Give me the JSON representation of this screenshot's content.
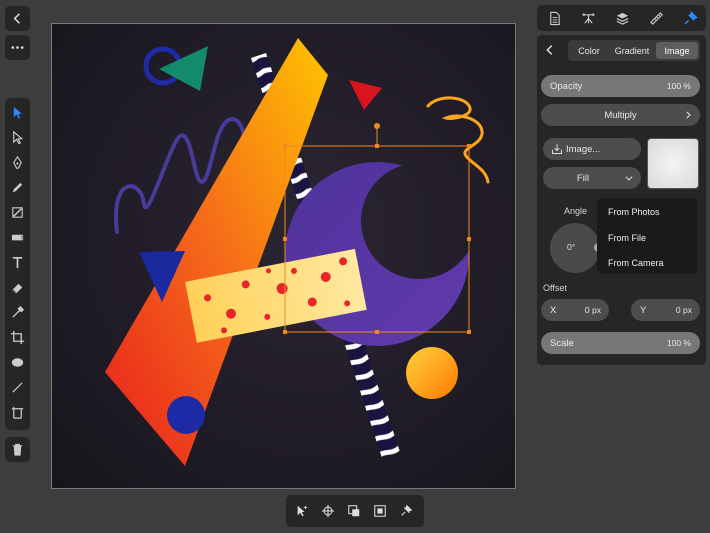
{
  "left_top": {
    "back_icon": "chevron-left",
    "more_icon": "ellipsis"
  },
  "tools": [
    "move-tool",
    "node-tool",
    "pen-tool",
    "pencil-tool",
    "vector-brush-tool",
    "fill-tool",
    "text-tool",
    "eraser-tool",
    "eyedropper-tool",
    "crop-tool",
    "ellipse-tool",
    "line-tool",
    "frame-tool"
  ],
  "panel": {
    "back_icon": "chevron-left",
    "tabs": [
      {
        "label": "Color",
        "active": false
      },
      {
        "label": "Gradient",
        "active": false
      },
      {
        "label": "Image",
        "active": true
      }
    ],
    "opacity": {
      "label": "Opacity",
      "value": "100 %"
    },
    "blend_mode": "Multiply",
    "image_button": "Image...",
    "fill_mode": "Fill",
    "angle": {
      "label": "Angle",
      "value": "0°"
    },
    "offset": {
      "label": "Offset",
      "x_label": "X",
      "x_value": "0 px",
      "y_label": "Y",
      "y_value": "0 px"
    },
    "scale": {
      "label": "Scale",
      "value": "100 %"
    }
  },
  "menu": {
    "items": [
      "From Photos",
      "From File",
      "From Camera"
    ]
  },
  "colors": {
    "accent": "#2e8bff",
    "selection": "#f18a1c",
    "panel_bg": "#262626",
    "app_bg": "#3d3d3d"
  }
}
